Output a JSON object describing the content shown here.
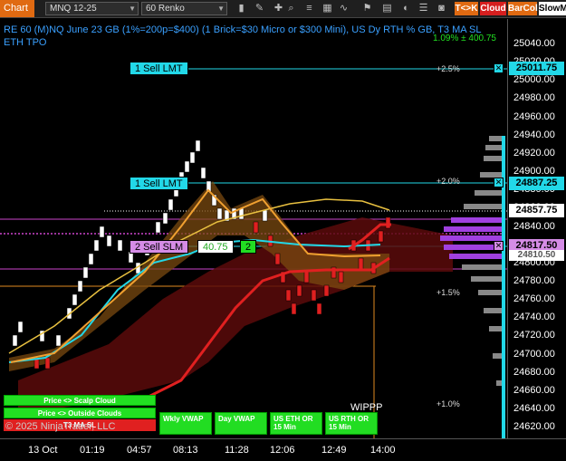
{
  "toolbar": {
    "chart_tab": "Chart",
    "instrument": "MNQ 12-25",
    "interval": "60 Renko",
    "tk_label": "T<>K",
    "cloud_label": "Cloud",
    "barcol_label": "BarCol",
    "slow_label": "SlowM",
    "accent": "#e06a12"
  },
  "title": {
    "line1": "RE 60 (M)NQ June 23 GB (1%=200p=$400) (1 Brick=$30 Micro or $300 Mini), US Dy RTH % GB, T3 MA SL",
    "line2": "ETH TPO",
    "badge": "1.09% ± 400.75"
  },
  "orders": {
    "sell_top": "1 Sell LMT",
    "sell_mid": "1 Sell LMT",
    "sell_slm": "2 Sell SLM",
    "slm_value": "40.75",
    "slm_qty": "2"
  },
  "price_tags": {
    "top": "25011.75",
    "mid": "24887.25",
    "current": "24857.75",
    "slm": "24817.50",
    "hidden_under": "24810.50"
  },
  "percent_levels": [
    "+2.5%",
    "+2.0%",
    "+1.5%",
    "+1.0%"
  ],
  "price_ticks": [
    "25040.00",
    "25020.00",
    "25000.00",
    "24980.00",
    "24960.00",
    "24940.00",
    "24920.00",
    "24900.00",
    "24880.00",
    "24860.00",
    "24840.00",
    "24820.00",
    "24800.00",
    "24780.00",
    "24760.00",
    "24740.00",
    "24720.00",
    "24700.00",
    "24680.00",
    "24660.00",
    "24640.00",
    "24620.00"
  ],
  "time_ticks": [
    "13 Oct",
    "01:19",
    "04:57",
    "08:13",
    "11:28",
    "12:06",
    "12:49",
    "14:00"
  ],
  "buttons": {
    "scalp": "Price <> Scalp Cloud",
    "outside": "Price <> Outside Clouds",
    "t3": "T3 MA SL",
    "wkly_vwap": "Wkly VWAP",
    "day_vwap": "Day VWAP",
    "us_eth": "US ETH OR 15 Min",
    "us_rth": "US RTH OR 15 Min"
  },
  "copyright": "© 2025 NinjaTrader, LLC",
  "wippp": "WIPPP",
  "colors": {
    "cyan": "#22d8e8",
    "green": "#22e022",
    "red": "#e02020",
    "purple": "#a040e0",
    "orange": "#e08a20"
  }
}
